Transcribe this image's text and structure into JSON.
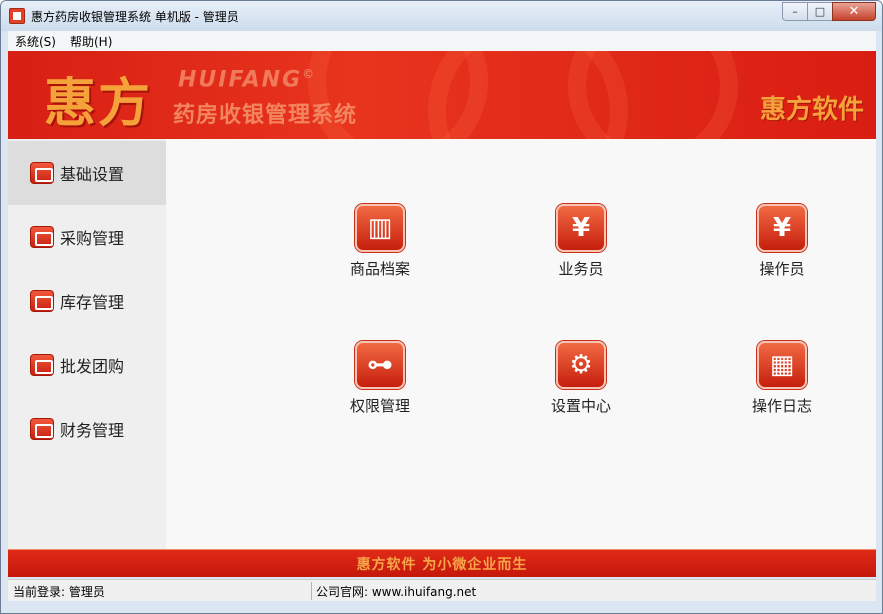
{
  "window": {
    "title": "惠方药房收银管理系统 单机版 - 管理员",
    "minimize_glyph": "–",
    "maximize_glyph": "□",
    "close_glyph": "✕"
  },
  "menubar": {
    "items": [
      {
        "label": "系统(S)"
      },
      {
        "label": "帮助(H)"
      }
    ]
  },
  "banner": {
    "logo_cn": "惠方",
    "logo_en": "HUIFANG",
    "logo_mark": "©",
    "subtitle": "药房收银管理系统",
    "brand_right": "惠方软件"
  },
  "sidebar": {
    "items": [
      {
        "label": "基础设置",
        "icon": "settings-icon",
        "active": true
      },
      {
        "label": "采购管理",
        "icon": "purchase-icon",
        "active": false
      },
      {
        "label": "库存管理",
        "icon": "inventory-icon",
        "active": false
      },
      {
        "label": "批发团购",
        "icon": "wholesale-icon",
        "active": false
      },
      {
        "label": "财务管理",
        "icon": "finance-icon",
        "active": false
      }
    ]
  },
  "tiles": [
    {
      "label": "商品档案",
      "icon": "product-files-icon",
      "glyph": "▥"
    },
    {
      "label": "业务员",
      "icon": "salesperson-icon",
      "glyph": "¥"
    },
    {
      "label": "操作员",
      "icon": "operator-icon",
      "glyph": "¥"
    },
    {
      "label": "权限管理",
      "icon": "permission-icon",
      "glyph": "⊶"
    },
    {
      "label": "设置中心",
      "icon": "gear-icon",
      "glyph": "⚙"
    },
    {
      "label": "操作日志",
      "icon": "log-table-icon",
      "glyph": "▦"
    }
  ],
  "footer": {
    "slogan": "惠方软件  为小微企业而生"
  },
  "status": {
    "login": "当前登录: 管理员",
    "website": "公司官网: www.ihuifang.net"
  },
  "colors": {
    "brand_red": "#d81f14",
    "brand_orange": "#f6a23a"
  }
}
